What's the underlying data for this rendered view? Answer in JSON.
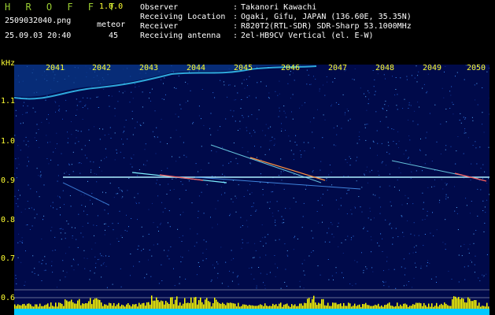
{
  "header": {
    "app_title": "H R O F F T",
    "app_version": "1.0.0",
    "filename": "2509032040.png",
    "datetime": "25.09.03 20:40",
    "meteor_label": "meteor",
    "meteor_count": "45",
    "info": [
      {
        "key": "Observer",
        "value": "Takanori Kawachi"
      },
      {
        "key": "Receiving Location",
        "value": "Ogaki, Gifu, JAPAN (136.60E, 35.35N)"
      },
      {
        "key": "Receiver",
        "value": "R820T2(RTL-SDR) SDR-Sharp 53.1000MHz"
      },
      {
        "key": "Receiving antenna",
        "value": "2el-HB9CV Vertical (el. E-W)"
      }
    ]
  },
  "axis": {
    "unit": "kHz",
    "x_ticks": [
      "2041",
      "2042",
      "2043",
      "2044",
      "2045",
      "2046",
      "2047",
      "2048",
      "2049",
      "2050"
    ],
    "y_ticks": [
      "1.1",
      "1.0",
      "0.9",
      "0.8",
      "0.7",
      "0.6"
    ]
  },
  "colors": {
    "tick": "#ffff33",
    "background": "#000a4a",
    "beacon": "#aeefff",
    "bars": "#ffff00",
    "baseline": "#00c8ff"
  }
}
